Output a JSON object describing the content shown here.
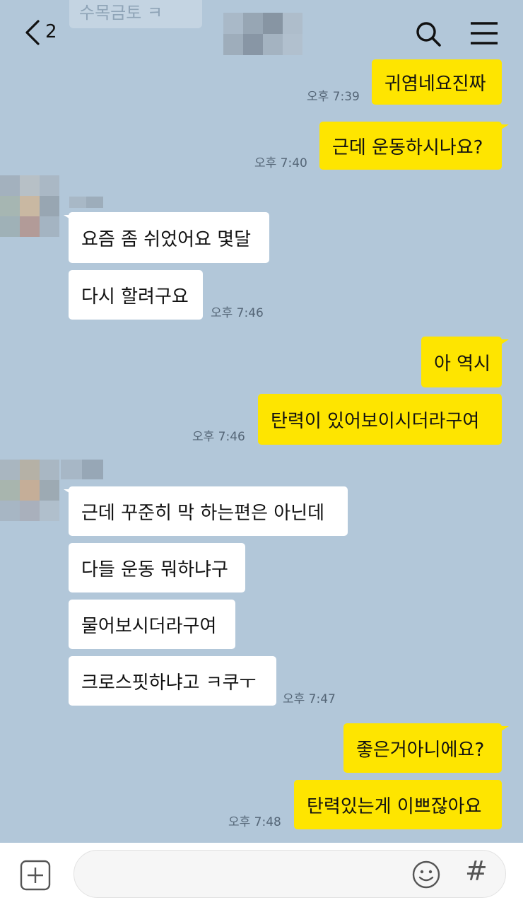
{
  "header": {
    "back_count": "2",
    "ghost_preview": "수목금토 ㅋ"
  },
  "messages": [
    {
      "from": "me",
      "text": "귀염네요진짜",
      "time": "오후 7:39"
    },
    {
      "from": "me",
      "text": "근데 운동하시나요?",
      "time": "오후 7:40"
    },
    {
      "from": "them",
      "text": "요즘 좀 쉬었어요 몇달"
    },
    {
      "from": "them",
      "text": "다시 할려구요",
      "time": "오후 7:46"
    },
    {
      "from": "me",
      "text": "아 역시"
    },
    {
      "from": "me",
      "text": "탄력이 있어보이시더라구여",
      "time": "오후 7:46"
    },
    {
      "from": "them",
      "text": "근데 꾸준히 막 하는편은 아닌데"
    },
    {
      "from": "them",
      "text": "다들 운동 뭐하냐구"
    },
    {
      "from": "them",
      "text": "물어보시더라구여"
    },
    {
      "from": "them",
      "text": "크로스핏하냐고 ㅋ쿠ㅜ",
      "time": "오후 7:47"
    },
    {
      "from": "me",
      "text": "좋은거아니에요?"
    },
    {
      "from": "me",
      "text": "탄력있는게 이쁘잖아요",
      "time": "오후 7:48"
    }
  ],
  "input": {
    "placeholder": "",
    "hash_label": "#"
  },
  "colors": {
    "background": "#b2c7d9",
    "my_bubble": "#fee500",
    "their_bubble": "#ffffff"
  }
}
